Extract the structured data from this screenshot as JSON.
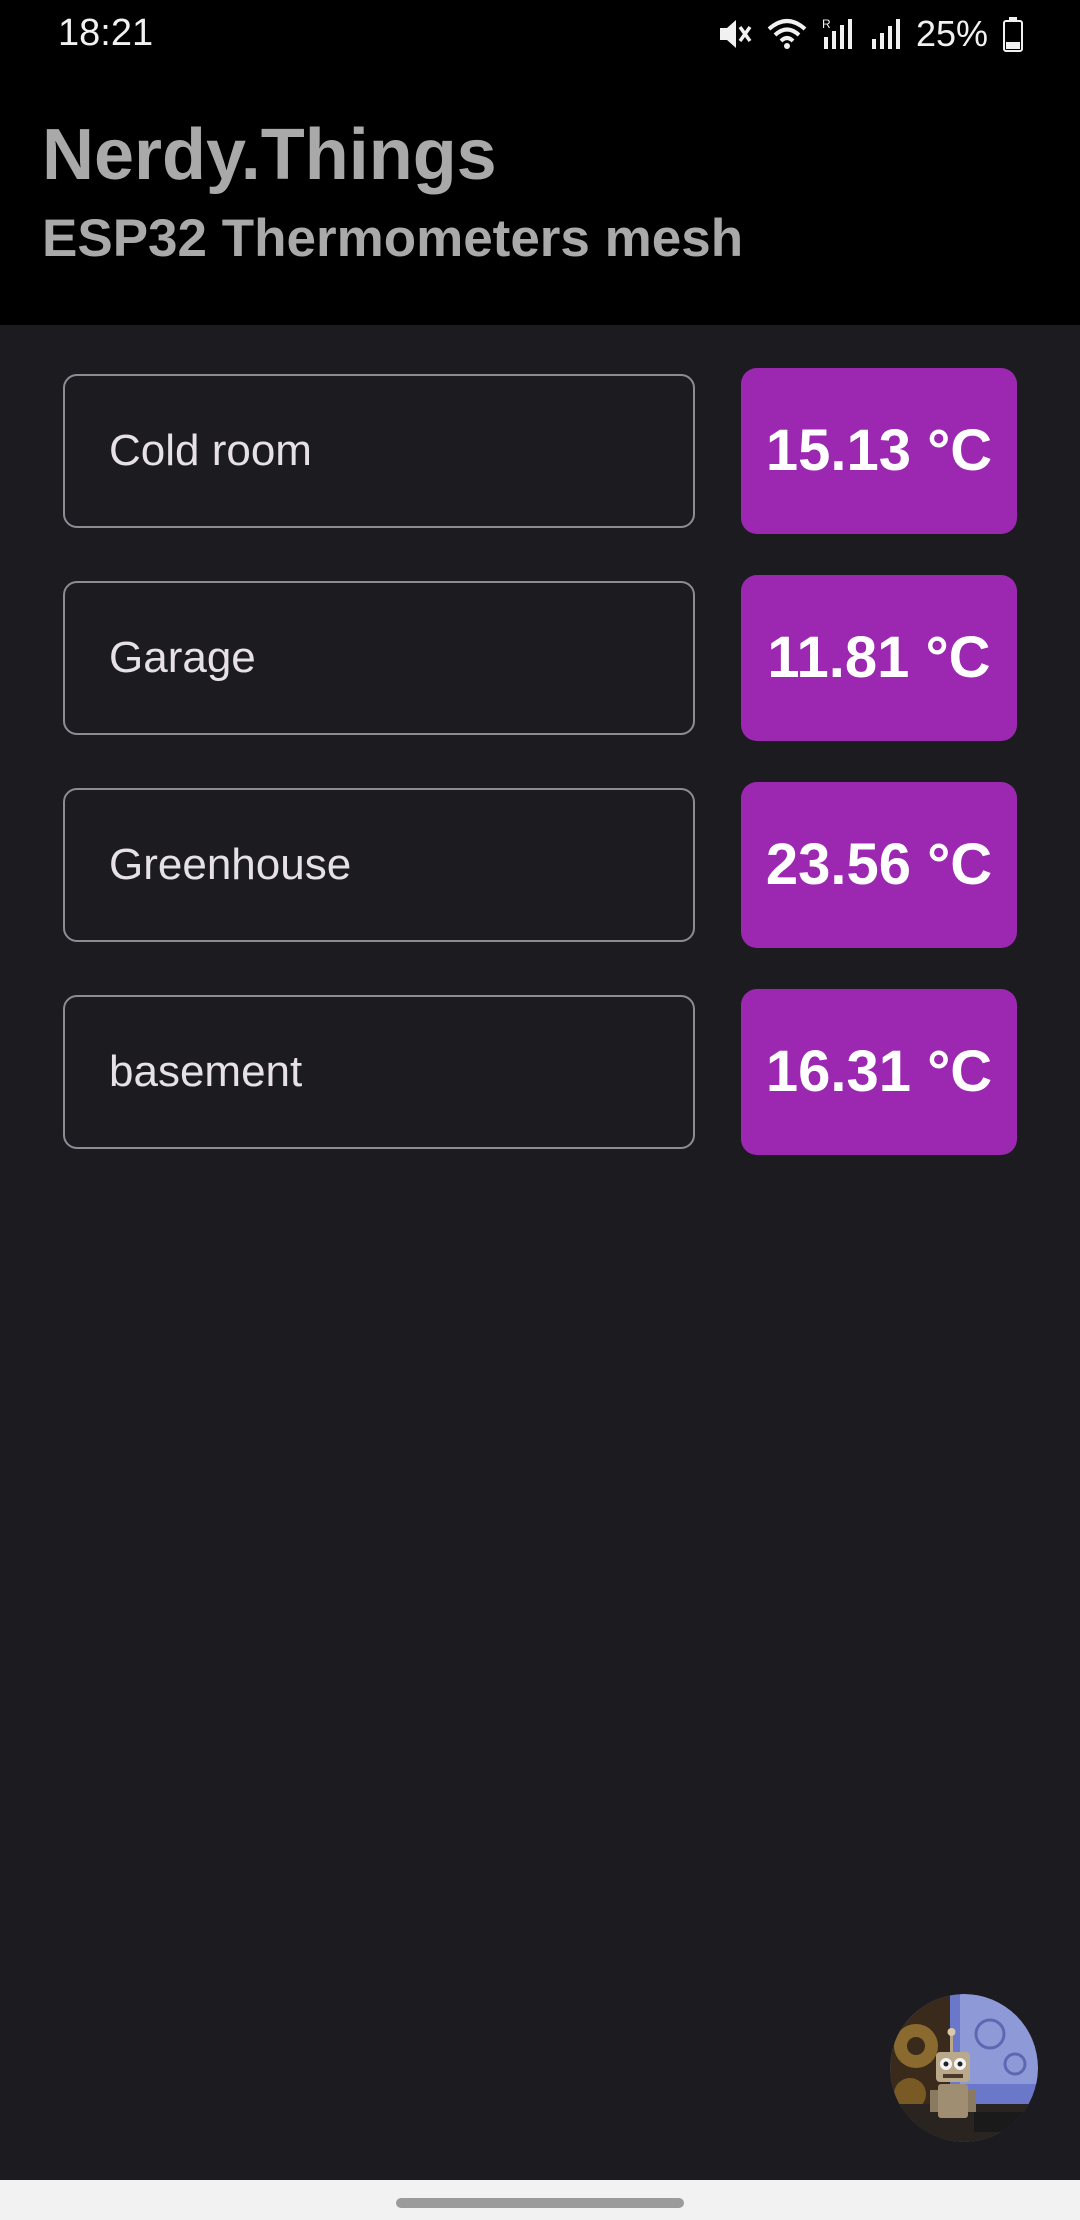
{
  "status_bar": {
    "time": "18:21",
    "battery_percent": "25%",
    "icons": [
      "mute-icon",
      "wifi-icon",
      "cell-signal-r-icon",
      "cell-signal-icon",
      "battery-icon"
    ],
    "battery_level": 0.25
  },
  "header": {
    "title": "Nerdy.Things",
    "subtitle": "ESP32 Thermometers mesh"
  },
  "sensors": [
    {
      "name": "Cold room",
      "temperature": "15.13 °C"
    },
    {
      "name": "Garage",
      "temperature": "11.81 °C"
    },
    {
      "name": "Greenhouse",
      "temperature": "23.56 °C"
    },
    {
      "name": "basement",
      "temperature": "16.31 °C"
    }
  ],
  "colors": {
    "header_background": "#000000",
    "page_background": "#1c1b20",
    "temperature_badge": "#9c27b0",
    "header_text": "#a9a9a9"
  },
  "avatar": {
    "icon": "robot-avatar-icon"
  }
}
